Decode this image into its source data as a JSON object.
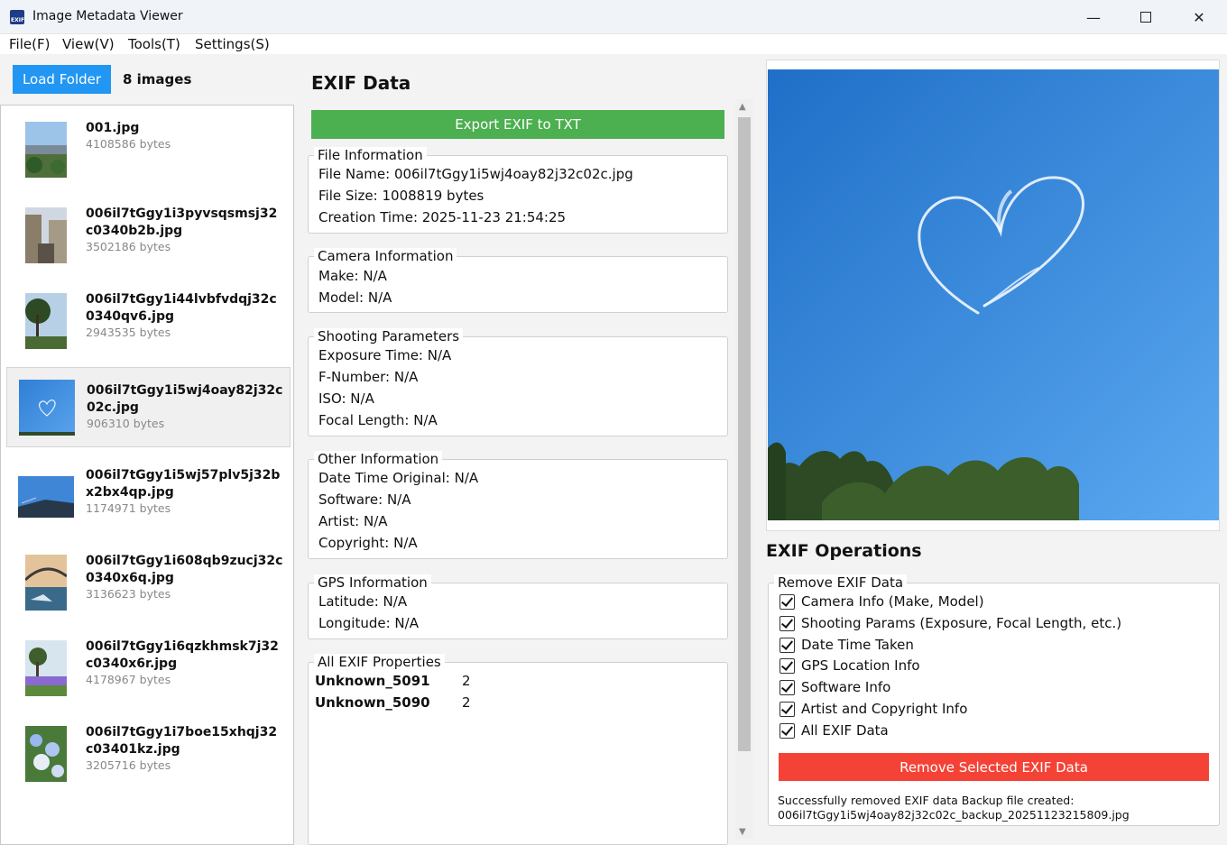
{
  "window": {
    "title": "Image Metadata Viewer",
    "min_icon": "minimize-icon",
    "max_icon": "maximize-icon",
    "close_icon": "close-icon"
  },
  "menu": [
    "File(F)",
    "View(V)",
    "Tools(T)",
    "Settings(S)"
  ],
  "left": {
    "load_label": "Load Folder",
    "count": "8 images",
    "files": [
      {
        "name": "001.jpg",
        "size": "4108586 bytes"
      },
      {
        "name": "006il7tGgy1i3pyvsqsmsj32c0340b2b.jpg",
        "size": "3502186 bytes"
      },
      {
        "name": "006il7tGgy1i44lvbfvdqj32c0340qv6.jpg",
        "size": "2943535 bytes"
      },
      {
        "name": "006il7tGgy1i5wj4oay82j32c02c.jpg",
        "size": "906310 bytes"
      },
      {
        "name": "006il7tGgy1i5wj57plv5j32bx2bx4qp.jpg",
        "size": "1174971 bytes"
      },
      {
        "name": "006il7tGgy1i608qb9zucj32c0340x6q.jpg",
        "size": "3136623 bytes"
      },
      {
        "name": "006il7tGgy1i6qzkhmsk7j32c0340x6r.jpg",
        "size": "4178967 bytes"
      },
      {
        "name": "006il7tGgy1i7boe15xhqj32c03401kz.jpg",
        "size": "3205716 bytes"
      }
    ]
  },
  "exif": {
    "title": "EXIF Data",
    "export_label": "Export EXIF to TXT",
    "file_info": {
      "title": "File Information",
      "file_name": "File Name: 006il7tGgy1i5wj4oay82j32c02c.jpg",
      "file_size": "File Size: 1008819 bytes",
      "creation_time": "Creation Time: 2025-11-23 21:54:25"
    },
    "camera_info": {
      "title": "Camera Information",
      "make": "Make: N/A",
      "model": "Model: N/A"
    },
    "shooting": {
      "title": "Shooting Parameters",
      "exposure": "Exposure Time: N/A",
      "fnumber": "F-Number: N/A",
      "iso": "ISO: N/A",
      "focal": "Focal Length: N/A"
    },
    "other": {
      "title": "Other Information",
      "datetime": "Date Time Original: N/A",
      "software": "Software: N/A",
      "artist": "Artist: N/A",
      "copyright": "Copyright: N/A"
    },
    "gps": {
      "title": "GPS Information",
      "lat": "Latitude: N/A",
      "lon": "Longitude: N/A"
    },
    "all": {
      "title": "All EXIF Properties",
      "props": [
        {
          "name": "Unknown_5091",
          "value": "2"
        },
        {
          "name": "Unknown_5090",
          "value": "2"
        }
      ]
    }
  },
  "ops": {
    "title": "EXIF Operations",
    "group_title": "Remove EXIF Data",
    "options": [
      "Camera Info (Make, Model)",
      "Shooting Params (Exposure, Focal Length, etc.)",
      "Date Time Taken",
      "GPS Location Info",
      "Software Info",
      "Artist and Copyright Info",
      "All EXIF Data"
    ],
    "remove_label": "Remove Selected EXIF Data",
    "status_line1": "Successfully removed EXIF data Backup file created:",
    "status_line2": "006il7tGgy1i5wj4oay82j32c02c_backup_20251123215809.jpg"
  },
  "colors": {
    "load": "#2196f3",
    "export": "#4caf50",
    "remove": "#f44336",
    "sky": "#3f8fe0"
  }
}
